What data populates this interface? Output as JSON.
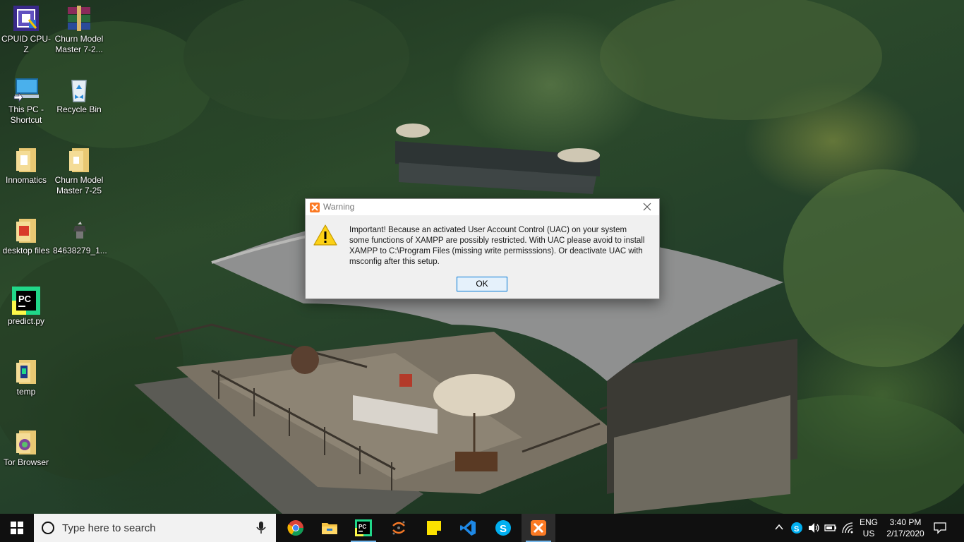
{
  "desktop": {
    "icons": [
      {
        "label": "CPUID CPU-Z",
        "icon": "cpu-z-icon"
      },
      {
        "label": "Churn Model Master 7-2...",
        "icon": "winrar-archive-icon"
      },
      {
        "label": "This PC - Shortcut",
        "icon": "this-pc-icon"
      },
      {
        "label": "Recycle Bin",
        "icon": "recycle-bin-icon"
      },
      {
        "label": "Innomatics",
        "icon": "folder-icon"
      },
      {
        "label": "Churn Model Master 7-25",
        "icon": "folder-icon"
      },
      {
        "label": "desktop files",
        "icon": "folder-icon"
      },
      {
        "label": "84638279_1...",
        "icon": "file-icon"
      },
      {
        "label": "predict.py",
        "icon": "pycharm-icon"
      },
      {
        "label": "temp",
        "icon": "folder-icon"
      },
      {
        "label": "Tor Browser",
        "icon": "folder-icon"
      }
    ]
  },
  "dialog": {
    "title": "Warning",
    "message": "Important! Because an activated User Account Control (UAC) on your system some functions of XAMPP are possibly restricted. With UAC please avoid to install XAMPP to C:\\Program Files (missing write permisssions). Or deactivate UAC with msconfig after this setup.",
    "ok_label": "OK"
  },
  "taskbar": {
    "search_placeholder": "Type here to search",
    "apps": [
      "chrome-icon",
      "file-explorer-icon",
      "pycharm-icon",
      "jupyter-icon",
      "sticky-notes-icon",
      "vscode-icon",
      "skype-icon",
      "xampp-icon"
    ],
    "language": {
      "line1": "ENG",
      "line2": "US"
    },
    "clock": {
      "time": "3:40 PM",
      "date": "2/17/2020"
    }
  },
  "colors": {
    "taskbar_bg": "#101010",
    "dialog_bg": "#f0f0f0",
    "accent": "#0078d7",
    "xampp_orange": "#fb7a24"
  }
}
